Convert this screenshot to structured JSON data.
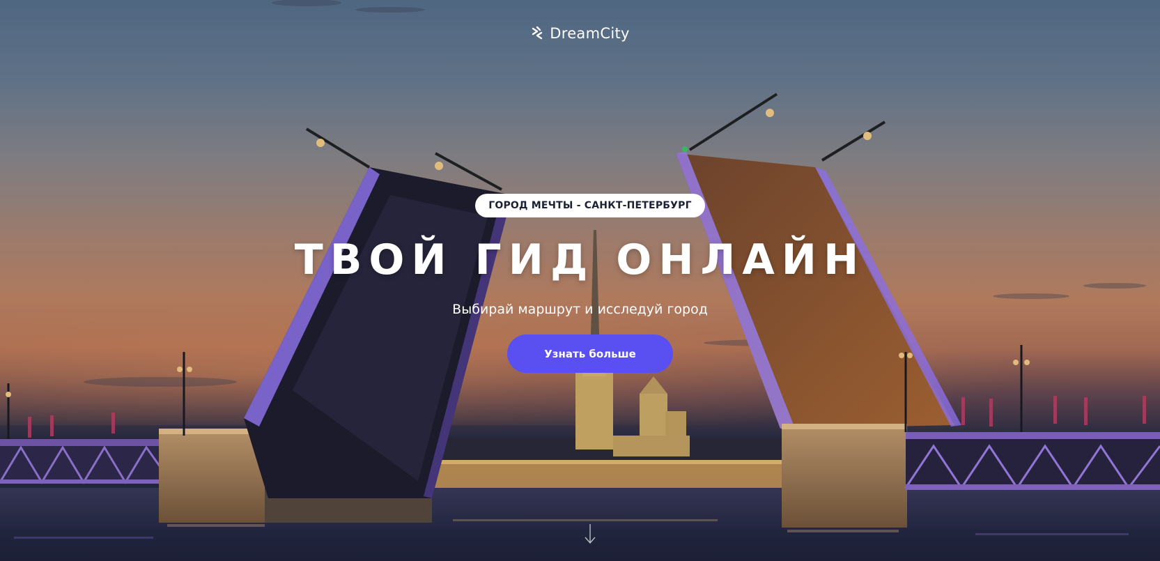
{
  "brand": {
    "name": "DreamCity",
    "icon": "dreamcity-logo-icon"
  },
  "hero": {
    "badge": "ГОРОД МЕЧТЫ - САНКТ-ПЕТЕРБУРГ",
    "title": "ТВОЙ ГИД ОНЛАЙН",
    "subtitle": "Выбирай маршрут и исследуй город",
    "cta_label": "Узнать больше",
    "scroll_icon": "arrow-down-icon"
  },
  "colors": {
    "accent": "#5a4ff0",
    "badge_bg": "#ffffff",
    "badge_text": "#1d2233",
    "text": "#ffffff"
  }
}
